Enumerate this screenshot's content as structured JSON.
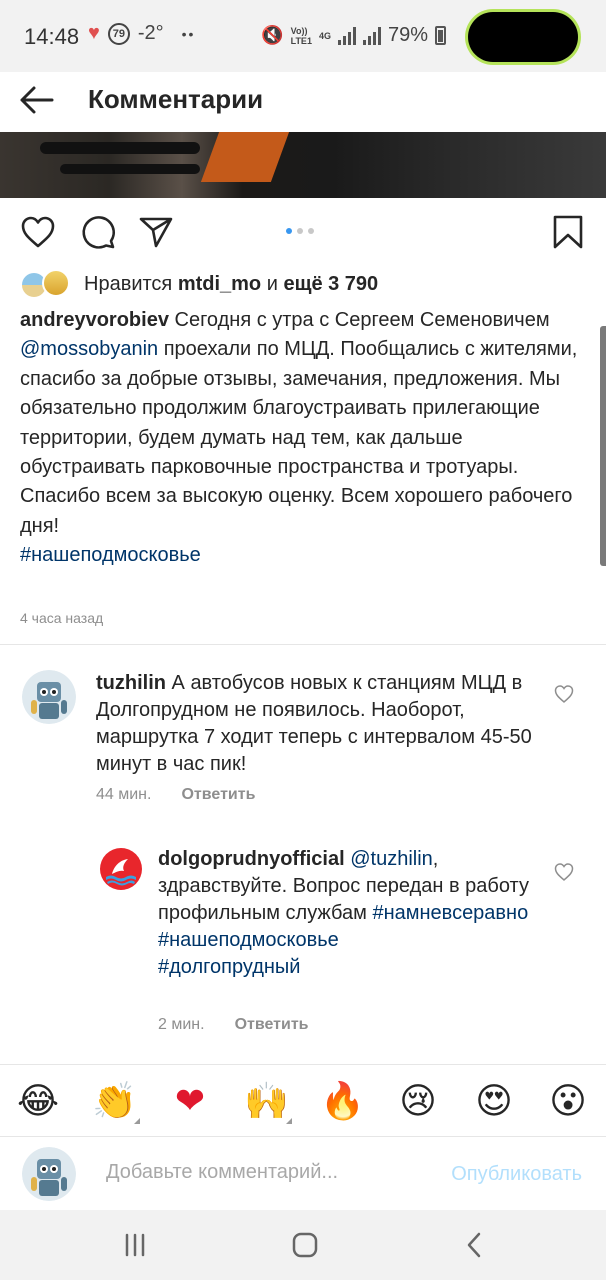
{
  "status_bar": {
    "time": "14:48",
    "aqi": "79",
    "temperature": "-2°",
    "more": "••",
    "network_top": "Vo))",
    "network_bottom": "LTE1",
    "network_type": "4G",
    "battery": "79%"
  },
  "header": {
    "title": "Комментарии",
    "back_icon": "arrow-left-icon"
  },
  "post": {
    "carousel": {
      "count": 3,
      "active": 1
    },
    "likes": {
      "prefix": "Нравится ",
      "user": "mtdi_mo",
      "middle": " и ",
      "count": "ещё 3 790"
    },
    "caption": {
      "user": "andreyvorobiev",
      "text_part1": " Сегодня с утра с Сергеем Семеновичем ",
      "mention": "@mossobyanin",
      "text_part2": " проехали по МЦД. Пообщались с жителями, спасибо за добрые отзывы, замечания, предложения. Мы обязательно продолжим благоустраивать прилегающие территории, будем думать над тем, как дальше обустраивать парковочные пространства и тротуары. Спасибо всем за высокую оценку. Всем хорошего рабочего дня!",
      "hashtag": "#нашеподмосковье"
    },
    "time_ago": "4 часа назад"
  },
  "comments": [
    {
      "user": "tuzhilin",
      "text": " А автобусов новых к станциям МЦД в Долгопрудном не появилось. Наоборот, маршрутка 7 ходит теперь с интервалом 45-50 минут в час пик!",
      "time": "44 мин.",
      "reply_label": "Ответить"
    },
    {
      "user": "dolgoprudnyofficial",
      "mention": " @tuzhilin",
      "text": ", здравствуйте. Вопрос передан в работу профильным службам ",
      "hashtag1": "#намневсеравно",
      "hashtag2": "#нашеподмосковье",
      "hashtag3": "#долгопрудный",
      "time": "2 мин.",
      "reply_label": "Ответить"
    }
  ],
  "emoji_bar": [
    "😂",
    "👏",
    "❤",
    "🙌",
    "🔥",
    "😢",
    "😍",
    "😮"
  ],
  "composer": {
    "placeholder": "Добавьте комментарий...",
    "publish_label": "Опубликовать"
  },
  "colors": {
    "link": "#003569",
    "publish_disabled": "#b2dffc",
    "carousel_active": "#3897f0"
  }
}
